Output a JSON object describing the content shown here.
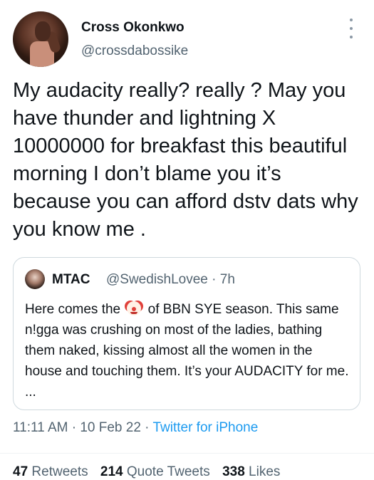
{
  "author": {
    "name": "Cross Okonkwo",
    "handle": "@crossdabossike"
  },
  "tweet": {
    "text": "My audacity really? really ? May you have thunder and lightning X 10000000 for breakfast this beautiful morning I don’t blame you it’s because you can afford dstv dats why you know me ."
  },
  "quoted_tweet": {
    "name": "MTAC",
    "handle_time": "@SwedishLovee · 7h",
    "text_before_emoji": "Here comes the",
    "emoji": "clown-face-icon",
    "text_after_emoji": "of BBN SYE season. This same n!gga was crushing on most of the ladies, bathing them naked, kissing almost all the women in the house and touching them. It’s your AUDACITY for me. ..."
  },
  "meta": {
    "time_date": "11:11 AM · 10 Feb 22 · ",
    "source": "Twitter for iPhone"
  },
  "stats": {
    "retweets_count": "47",
    "retweets_label": "Retweets",
    "quotes_count": "214",
    "quotes_label": "Quote Tweets",
    "likes_count": "338",
    "likes_label": "Likes"
  },
  "colors": {
    "text_primary": "#0f1419",
    "text_secondary": "#536471",
    "link": "#1d9bf0",
    "border": "#cfd9de"
  }
}
